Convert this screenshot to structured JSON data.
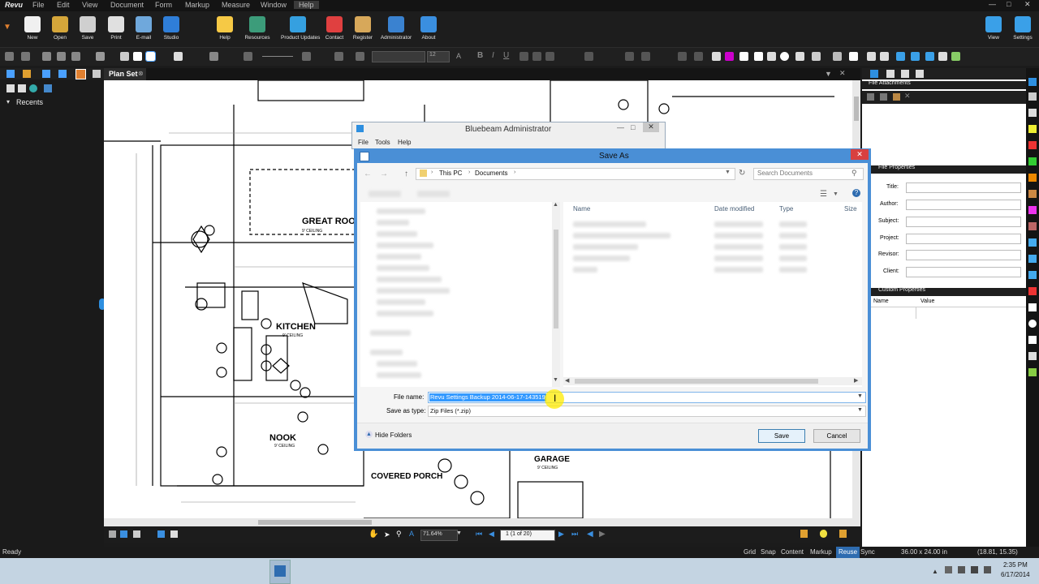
{
  "menu": [
    "File",
    "Edit",
    "View",
    "Document",
    "Form",
    "Markup",
    "Measure",
    "Window",
    "Help"
  ],
  "ribbon_buttons": [
    {
      "label": "New",
      "color": "#f0f0f0"
    },
    {
      "label": "Open",
      "color": "#d5a63a"
    },
    {
      "label": "Save",
      "color": "#cfcfcf"
    },
    {
      "label": "Print",
      "color": "#e0e0e0"
    },
    {
      "label": "E-mail",
      "color": "#6fa8dc"
    },
    {
      "label": "Studio",
      "color": "#2f7ed8"
    },
    {
      "label": "Help",
      "color": "#f6c945"
    },
    {
      "label": "Resources",
      "color": "#3c9c7a"
    },
    {
      "label": "Product Updates",
      "color": "#35a0e0"
    },
    {
      "label": "Contact",
      "color": "#e04040"
    },
    {
      "label": "Register",
      "color": "#d7a85a"
    },
    {
      "label": "Administrator",
      "color": "#3a82d0"
    },
    {
      "label": "About",
      "color": "#3a8fe0"
    }
  ],
  "ribbon_right": [
    {
      "label": "View",
      "color": "#3aa0e8"
    },
    {
      "label": "Settings",
      "color": "#3aa0e8"
    }
  ],
  "font_size_value": "12",
  "left_panel": {
    "section": "Recents"
  },
  "document_tab": "Plan Set",
  "drawing_labels": {
    "great_room": "GREAT ROO",
    "kitchen": "KITCHEN",
    "nook": "NOOK",
    "covered_porch": "COVERED PORCH",
    "garage": "GARAGE",
    "ceiling": "9' CEILING"
  },
  "admin_dialog": {
    "title": "Bluebeam Administrator",
    "menu": [
      "File",
      "Tools",
      "Help"
    ]
  },
  "save_as": {
    "title": "Save As",
    "breadcrumb": [
      "This PC",
      "Documents"
    ],
    "search_placeholder": "Search Documents",
    "columns": [
      "Name",
      "Date modified",
      "Type",
      "Size"
    ],
    "file_name_label": "File name:",
    "file_name_value": "Revu Settings Backup 2014-06-17-143519",
    "save_as_type_label": "Save as type:",
    "save_as_type_value": "Zip Files (*.zip)",
    "hide_folders": "Hide Folders",
    "save_button": "Save",
    "cancel_button": "Cancel"
  },
  "right_panel": {
    "attachments_title": "File Attachments",
    "properties_title": "File Properties",
    "fields": [
      "Title:",
      "Author:",
      "Subject:",
      "Project:",
      "Revisor:",
      "Client:"
    ],
    "custom_title": "Custom Properties",
    "custom_columns": [
      "Name",
      "Value"
    ]
  },
  "navbar": {
    "zoom": "71.64%",
    "page": "1 (1 of 20)"
  },
  "status": {
    "ready": "Ready",
    "toggles": [
      "Grid",
      "Snap",
      "Content",
      "Markup",
      "Reuse",
      "Sync"
    ],
    "active_toggle": "Reuse",
    "size": "36.00 x 24.00 in",
    "coords": "(18.81, 15.35)"
  },
  "taskbar": {
    "time": "2:35 PM",
    "date": "6/17/2014"
  }
}
